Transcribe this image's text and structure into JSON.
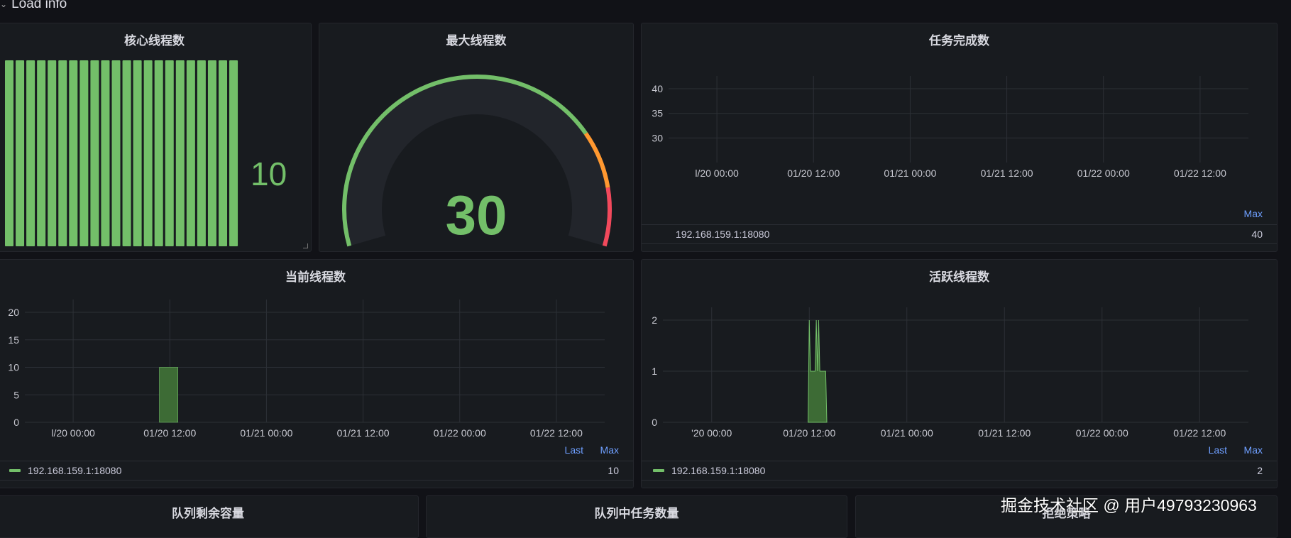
{
  "row": {
    "title": "Load info"
  },
  "core": {
    "title": "核心线程数",
    "value": "10",
    "bar_count": 22,
    "color": "#73bf69"
  },
  "max": {
    "title": "最大线程数",
    "value": "30",
    "gauge": {
      "min": 0,
      "max": 30,
      "value": 30,
      "thresholds": [
        {
          "color": "#73bf69",
          "to": 0.76
        },
        {
          "color": "#ff9830",
          "to": 0.88
        },
        {
          "color": "#f2495c",
          "to": 1.0
        }
      ]
    }
  },
  "tasks": {
    "title": "任务完成数",
    "chart_data": {
      "type": "line",
      "y_ticks": [
        "40",
        "35",
        "30"
      ],
      "x_ticks": [
        "l/20 00:00",
        "01/20 12:00",
        "01/21 00:00",
        "01/21 12:00",
        "01/22 00:00",
        "01/22 12:00"
      ],
      "series": []
    },
    "legend": {
      "headers": [
        "Max"
      ],
      "rows": [
        {
          "name": "192.168.159.1:18080",
          "values": [
            "40"
          ],
          "show_swatch": false
        }
      ]
    }
  },
  "current": {
    "title": "当前线程数",
    "chart_data": {
      "type": "bar",
      "y_ticks": [
        "20",
        "15",
        "10",
        "5",
        "0"
      ],
      "ylim": [
        0,
        20
      ],
      "x_ticks": [
        "l/20 00:00",
        "01/20 12:00",
        "01/21 00:00",
        "01/21 12:00",
        "01/22 00:00",
        "01/22 12:00"
      ],
      "bars": [
        {
          "x": 0.232,
          "width": 0.032,
          "value": 10
        }
      ]
    },
    "legend": {
      "headers": [
        "Last",
        "Max"
      ],
      "rows": [
        {
          "name": "192.168.159.1:18080",
          "values": [
            "",
            "10"
          ],
          "show_swatch": true
        }
      ]
    }
  },
  "active": {
    "title": "活跃线程数",
    "chart_data": {
      "type": "area",
      "y_ticks": [
        "2",
        "1",
        "0"
      ],
      "ylim": [
        0,
        2
      ],
      "x_ticks": [
        "'20 00:00",
        "01/20 12:00",
        "01/21 00:00",
        "01/21 12:00",
        "01/22 00:00",
        "01/22 12:00"
      ],
      "x": [
        0.248,
        0.25,
        0.252,
        0.254,
        0.256,
        0.258,
        0.26,
        0.262,
        0.264,
        0.266,
        0.268,
        0.27,
        0.272,
        0.274,
        0.276,
        0.278,
        0.28
      ],
      "values": [
        0,
        2,
        1,
        1,
        1,
        1,
        1,
        2,
        1,
        2,
        1,
        1,
        1,
        1,
        1,
        1,
        0
      ]
    },
    "legend": {
      "headers": [
        "Last",
        "Max"
      ],
      "rows": [
        {
          "name": "192.168.159.1:18080",
          "values": [
            "",
            "2"
          ],
          "show_swatch": true
        }
      ]
    }
  },
  "bottom": {
    "titles": [
      "队列剩余容量",
      "队列中任务数量",
      "拒绝策略"
    ]
  },
  "watermark": "掘金技术社区 @ 用户49793230963"
}
